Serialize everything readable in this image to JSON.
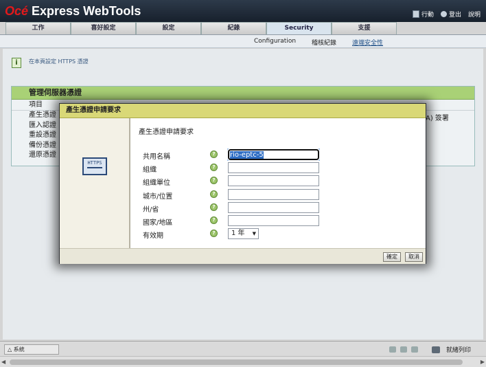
{
  "app": {
    "brand_prefix": "Océ",
    "brand_rest": " Express WebTools"
  },
  "top_links": {
    "jobs": "行動",
    "logout": "登出",
    "help": "說明"
  },
  "tabs": [
    "工作",
    "喜好設定",
    "設定",
    "紀錄",
    "Security",
    "支援"
  ],
  "active_tab": "Security",
  "subnav": [
    "Configuration",
    "稽核紀錄",
    "遠端安全性"
  ],
  "active_subnav": "遠端安全性",
  "info": {
    "icon": "i",
    "text": "在本頁設定 HTTPS 憑證"
  },
  "panel": {
    "title": "管理伺服器憑證",
    "column_header": "項目",
    "rows": [
      "產生憑證",
      "匯入認證",
      "重設憑證",
      "備份憑證",
      "還原憑證"
    ],
    "tail_text": "A) 簽署"
  },
  "dialog": {
    "title": "產生憑證申請要求",
    "section_title": "產生憑證申請要求",
    "icon_text": "HTTPS",
    "fields": [
      {
        "label": "共用名稱",
        "value": "rio-eptc-5"
      },
      {
        "label": "組織",
        "value": ""
      },
      {
        "label": "組織單位",
        "value": ""
      },
      {
        "label": "城市/位置",
        "value": ""
      },
      {
        "label": "州/省",
        "value": ""
      },
      {
        "label": "國家/地區",
        "value": ""
      }
    ],
    "validity": {
      "label": "有效期",
      "value": "1 年"
    },
    "ok_label": "確定",
    "cancel_label": "取消"
  },
  "statusbar": {
    "system": "系統",
    "print_queue": "就緒列印"
  }
}
